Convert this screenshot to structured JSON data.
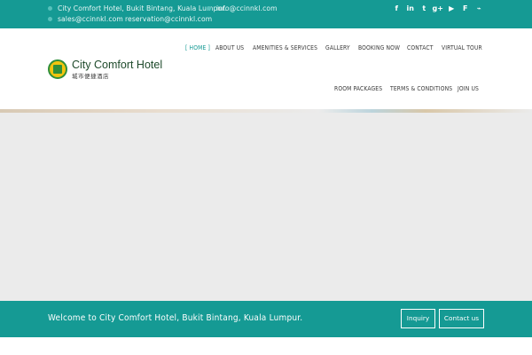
{
  "topbar": {
    "address": "City Comfort Hotel, Bukit Bintang, Kuala Lumpur.",
    "email_info": "info@ccinnkl.com",
    "email_sales": "sales@ccinnkl.com",
    "email_reservation": "reservation@ccinnkl.com",
    "social": [
      {
        "name": "facebook-icon",
        "glyph": "f"
      },
      {
        "name": "linkedin-icon",
        "glyph": "in"
      },
      {
        "name": "twitter-icon",
        "glyph": "t"
      },
      {
        "name": "google-plus-icon",
        "glyph": "g+"
      },
      {
        "name": "youtube-icon",
        "glyph": "▶"
      },
      {
        "name": "foursquare-icon",
        "glyph": "F"
      },
      {
        "name": "rss-icon",
        "glyph": "⌁"
      }
    ]
  },
  "logo": {
    "name": "City Comfort Hotel",
    "subtitle": "城市便捷酒店"
  },
  "nav": {
    "row1": [
      "[ HOME ]",
      "ABOUT US",
      "AMENITIES & SERVICES",
      "GALLERY",
      "BOOKING NOW",
      "CONTACT",
      "VIRTUAL TOUR"
    ],
    "row2": [
      "ROOM PACKAGES",
      "TERMS & CONDITIONS",
      "JOIN US"
    ]
  },
  "welcome": {
    "text": "Welcome to City Comfort Hotel, Bukit Bintang, Kuala Lumpur.",
    "inquiry_label": "Inquiry",
    "contact_label": "Contact us"
  },
  "colors": {
    "brand": "#159a94",
    "text": "#3a3a3a"
  }
}
